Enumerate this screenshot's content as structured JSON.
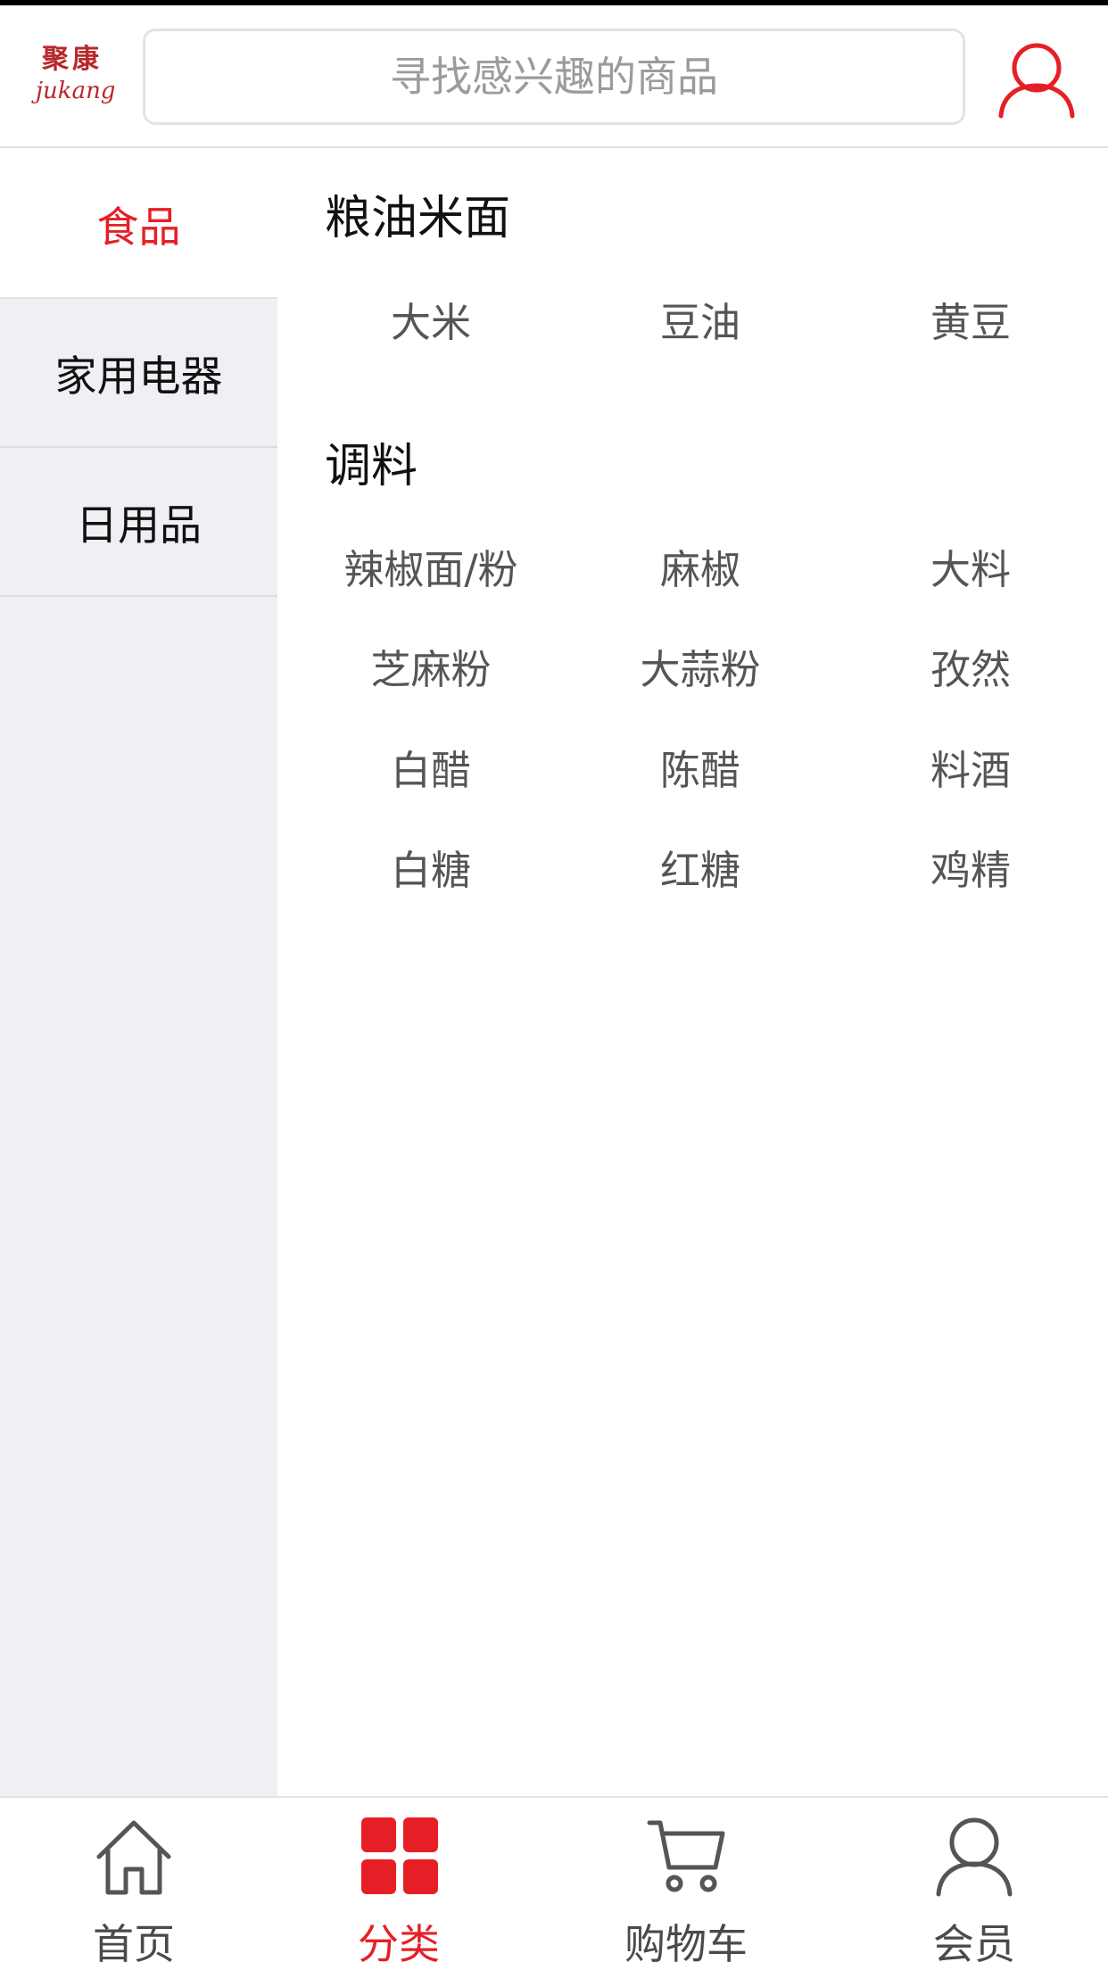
{
  "header": {
    "logo_cn": "聚康",
    "logo_en": "jukang",
    "search_placeholder": "寻找感兴趣的商品"
  },
  "sidebar": {
    "items": [
      {
        "label": "食品",
        "active": true
      },
      {
        "label": "家用电器",
        "active": false
      },
      {
        "label": "日用品",
        "active": false
      }
    ]
  },
  "content": {
    "sections": [
      {
        "title": "粮油米面",
        "items": [
          "大米",
          "豆油",
          "黄豆"
        ]
      },
      {
        "title": "调料",
        "items": [
          "辣椒面/粉",
          "麻椒",
          "大料",
          "芝麻粉",
          "大蒜粉",
          "孜然",
          "白醋",
          "陈醋",
          "料酒",
          "白糖",
          "红糖",
          "鸡精"
        ]
      }
    ]
  },
  "tabbar": {
    "tabs": [
      {
        "label": "首页",
        "icon": "home-icon"
      },
      {
        "label": "分类",
        "icon": "category-grid-icon",
        "active": true
      },
      {
        "label": "购物车",
        "icon": "cart-icon"
      },
      {
        "label": "会员",
        "icon": "member-icon"
      }
    ]
  },
  "colors": {
    "accent": "#e61f26",
    "sidebar_bg": "#f0eff4",
    "logo": "#b8282b"
  }
}
